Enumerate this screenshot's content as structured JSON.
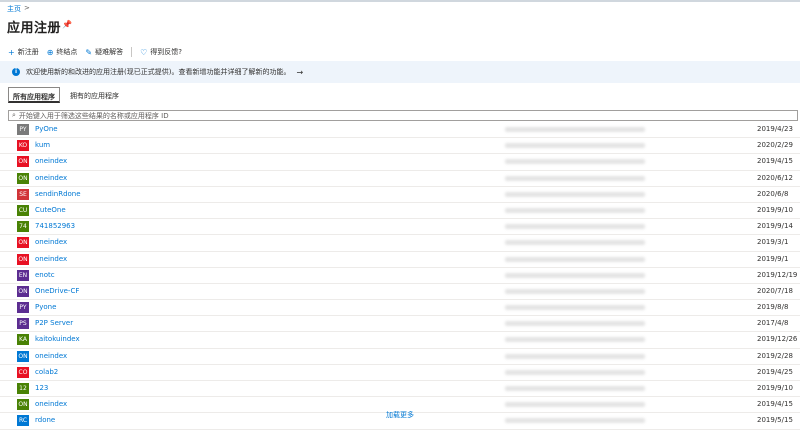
{
  "breadcrumb": {
    "home": "主页",
    "separator": ">"
  },
  "page": {
    "title": "应用注册",
    "pin_icon": "pin-icon"
  },
  "toolbar": {
    "new_registration": "新注册",
    "endpoints": "终结点",
    "troubleshooting": "疑难解答",
    "feedback": "得到反馈?"
  },
  "banner": {
    "text": "欢迎使用新的和改进的应用注册(现已正式提供)。查看新增功能并详细了解新的功能。",
    "arrow": "→"
  },
  "tabs": {
    "all_apps": "所有应用程序",
    "owned_apps": "拥有的应用程序"
  },
  "search": {
    "placeholder": "开始键入用于筛选这些结果的名称或应用程序 ID"
  },
  "colors": {
    "gray": "#6e6e6e",
    "red": "#e81123",
    "green": "#498205",
    "purple": "#5c2d91",
    "dark_red": "#c50f1f",
    "blue": "#0078d4",
    "teal": "#107c10"
  },
  "apps": [
    {
      "badge": "PY",
      "color": "#7a7a7a",
      "name": "PyOne",
      "date": "2019/4/23"
    },
    {
      "badge": "KO",
      "color": "#e81123",
      "name": "kum",
      "date": "2020/2/29"
    },
    {
      "badge": "ON",
      "color": "#e81123",
      "name": "oneindex",
      "date": "2019/4/15"
    },
    {
      "badge": "ON",
      "color": "#498205",
      "name": "oneindex",
      "date": "2020/6/12"
    },
    {
      "badge": "SE",
      "color": "#d13438",
      "name": "sendinRdone",
      "date": "2020/6/8"
    },
    {
      "badge": "CU",
      "color": "#498205",
      "name": "CuteOne",
      "date": "2019/9/10"
    },
    {
      "badge": "74",
      "color": "#498205",
      "name": "741852963",
      "date": "2019/9/14"
    },
    {
      "badge": "ON",
      "color": "#e81123",
      "name": "oneindex",
      "date": "2019/3/1"
    },
    {
      "badge": "ON",
      "color": "#e81123",
      "name": "oneindex",
      "date": "2019/9/1"
    },
    {
      "badge": "EN",
      "color": "#5c2d91",
      "name": "enotc",
      "date": "2019/12/19"
    },
    {
      "badge": "ON",
      "color": "#5c2d91",
      "name": "OneDrive-CF",
      "date": "2020/7/18"
    },
    {
      "badge": "PY",
      "color": "#5c2d91",
      "name": "Pyone",
      "date": "2019/8/8"
    },
    {
      "badge": "PS",
      "color": "#5c2d91",
      "name": "P2P Server",
      "date": "2017/4/8"
    },
    {
      "badge": "KA",
      "color": "#498205",
      "name": "kaitokuindex",
      "date": "2019/12/26"
    },
    {
      "badge": "ON",
      "color": "#0078d4",
      "name": "oneindex",
      "date": "2019/2/28"
    },
    {
      "badge": "CO",
      "color": "#e81123",
      "name": "colab2",
      "date": "2019/4/25"
    },
    {
      "badge": "12",
      "color": "#498205",
      "name": "123",
      "date": "2019/9/10"
    },
    {
      "badge": "ON",
      "color": "#498205",
      "name": "oneindex",
      "date": "2019/4/15"
    },
    {
      "badge": "RC",
      "color": "#0078d4",
      "name": "rdone",
      "date": "2019/5/15"
    }
  ],
  "load_more": "加载更多"
}
